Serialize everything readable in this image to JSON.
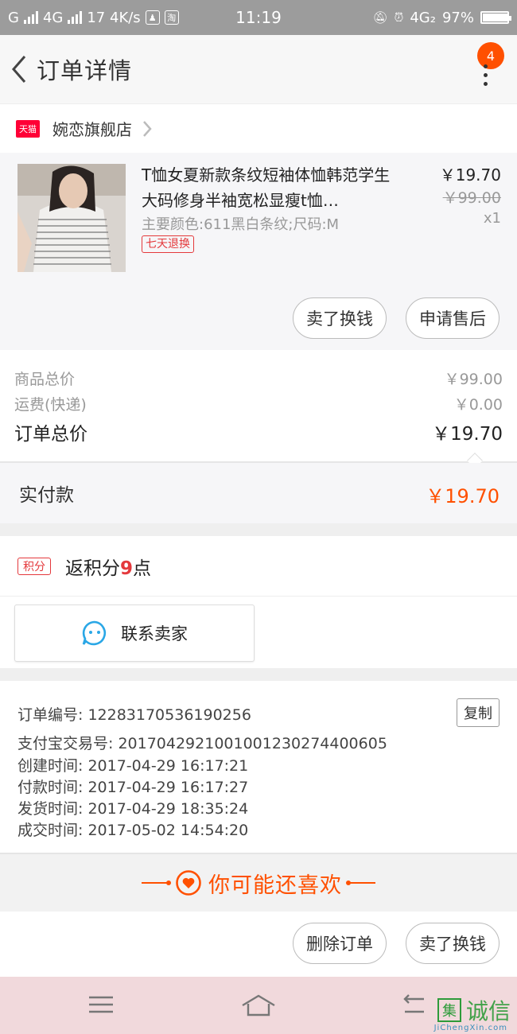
{
  "status_bar": {
    "left_text": "G",
    "network_1": "4G",
    "data_rate": "17 4K/s",
    "qq_icon": "qq-icon",
    "taobao_icon": "淘",
    "time": "11:19",
    "network_2": "4G₂",
    "battery": "97%",
    "battery_level": 0.97
  },
  "header": {
    "title": "订单详情",
    "badge_count": "4"
  },
  "shop": {
    "tmall_label": "天猫",
    "name": "婉恋旗舰店"
  },
  "item": {
    "title": "T恤女夏新款条纹短袖体恤韩范学生大码修身半袖宽松显瘦t恤…",
    "sku": "主要颜色:611黑白条纹;尺码:M",
    "return_tag": "七天退换",
    "price": "￥19.70",
    "original_price": "￥99.00",
    "quantity": "x1",
    "btn_refund": "卖了换钱",
    "btn_aftersale": "申请售后"
  },
  "summary": {
    "goods_total_label": "商品总价",
    "goods_total_value": "￥99.00",
    "shipping_label": "运费(快递)",
    "shipping_value": "￥0.00",
    "order_total_label": "订单总价",
    "order_total_value": "￥19.70"
  },
  "paid": {
    "label": "实付款",
    "amount": "￥19.70"
  },
  "points": {
    "tag": "积分",
    "text_prefix": "返积分",
    "number": "9",
    "text_suffix": "点"
  },
  "contact": {
    "label": "联系卖家"
  },
  "order_info": {
    "order_no": "订单编号: 12283170536190256",
    "alipay_no": "支付宝交易号: 2017042921001001230274400605",
    "created": "创建时间: 2017-04-29  16:17:21",
    "paid": "付款时间: 2017-04-29  16:17:27",
    "shipped": "发货时间: 2017-04-29  18:35:24",
    "completed": "成交时间: 2017-05-02  14:54:20",
    "copy_label": "复制"
  },
  "recommend": {
    "label": "你可能还喜欢"
  },
  "bottom_actions": {
    "delete_label": "删除订单",
    "sell_label": "卖了换钱"
  },
  "watermark": {
    "box": "集",
    "text": "诚信",
    "sub": "JiChengXin.com"
  },
  "colors": {
    "accent": "#ff5000",
    "tmall_red": "#ff0036",
    "tag_red": "#e4393c",
    "contact_blue": "#2aa7e6"
  }
}
